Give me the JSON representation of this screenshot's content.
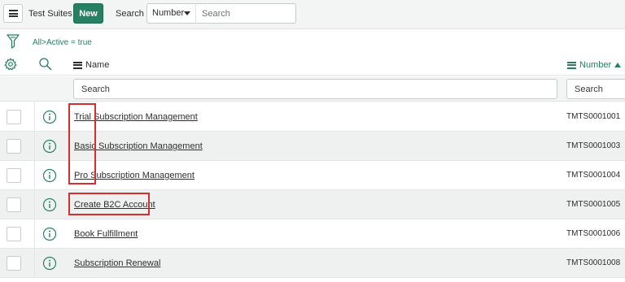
{
  "toolbar": {
    "title": "Test Suites",
    "new_label": "New",
    "search_label": "Search",
    "search_field": {
      "selected": "Number",
      "options": [
        "Number"
      ]
    },
    "search_placeholder": "Search"
  },
  "breadcrumb": {
    "all": "All",
    "separator": ">",
    "condition": "Active = true"
  },
  "columns": {
    "name": "Name",
    "number": "Number",
    "number_sort": "ascending"
  },
  "filters": {
    "name_placeholder": "Search",
    "number_placeholder": "Search"
  },
  "rows": [
    {
      "name": "Trial Subscription Management",
      "number": "TMTS0001001"
    },
    {
      "name": "Basic Subscription Management",
      "number": "TMTS0001003"
    },
    {
      "name": "Pro Subscription Management",
      "number": "TMTS0001004"
    },
    {
      "name": "Create B2C Account",
      "number": "TMTS0001005"
    },
    {
      "name": "Book Fulfillment",
      "number": "TMTS0001006"
    },
    {
      "name": "Subscription Renewal",
      "number": "TMTS0001008"
    }
  ],
  "colors": {
    "accent_green": "#278062",
    "highlight_red": "#d62e2e",
    "row_alt": "#eff1f1"
  },
  "icons": [
    "menu-icon",
    "funnel-icon",
    "gear-icon",
    "search-icon",
    "info-icon",
    "list-lines-icon",
    "sort-ascending-icon"
  ]
}
